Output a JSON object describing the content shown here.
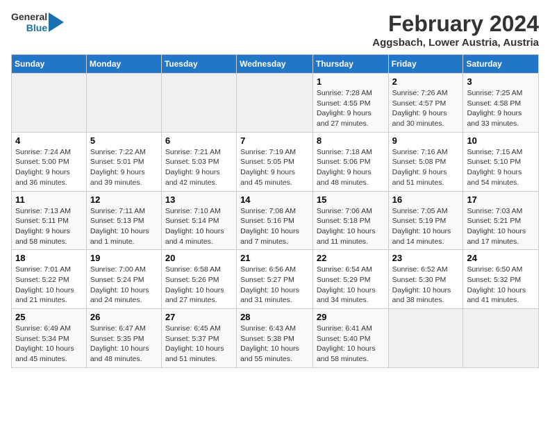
{
  "logo": {
    "text_general": "General",
    "text_blue": "Blue"
  },
  "title": "February 2024",
  "subtitle": "Aggsbach, Lower Austria, Austria",
  "columns": [
    "Sunday",
    "Monday",
    "Tuesday",
    "Wednesday",
    "Thursday",
    "Friday",
    "Saturday"
  ],
  "weeks": [
    [
      {
        "day": "",
        "info": ""
      },
      {
        "day": "",
        "info": ""
      },
      {
        "day": "",
        "info": ""
      },
      {
        "day": "",
        "info": ""
      },
      {
        "day": "1",
        "info": "Sunrise: 7:28 AM\nSunset: 4:55 PM\nDaylight: 9 hours and 27 minutes."
      },
      {
        "day": "2",
        "info": "Sunrise: 7:26 AM\nSunset: 4:57 PM\nDaylight: 9 hours and 30 minutes."
      },
      {
        "day": "3",
        "info": "Sunrise: 7:25 AM\nSunset: 4:58 PM\nDaylight: 9 hours and 33 minutes."
      }
    ],
    [
      {
        "day": "4",
        "info": "Sunrise: 7:24 AM\nSunset: 5:00 PM\nDaylight: 9 hours and 36 minutes."
      },
      {
        "day": "5",
        "info": "Sunrise: 7:22 AM\nSunset: 5:01 PM\nDaylight: 9 hours and 39 minutes."
      },
      {
        "day": "6",
        "info": "Sunrise: 7:21 AM\nSunset: 5:03 PM\nDaylight: 9 hours and 42 minutes."
      },
      {
        "day": "7",
        "info": "Sunrise: 7:19 AM\nSunset: 5:05 PM\nDaylight: 9 hours and 45 minutes."
      },
      {
        "day": "8",
        "info": "Sunrise: 7:18 AM\nSunset: 5:06 PM\nDaylight: 9 hours and 48 minutes."
      },
      {
        "day": "9",
        "info": "Sunrise: 7:16 AM\nSunset: 5:08 PM\nDaylight: 9 hours and 51 minutes."
      },
      {
        "day": "10",
        "info": "Sunrise: 7:15 AM\nSunset: 5:10 PM\nDaylight: 9 hours and 54 minutes."
      }
    ],
    [
      {
        "day": "11",
        "info": "Sunrise: 7:13 AM\nSunset: 5:11 PM\nDaylight: 9 hours and 58 minutes."
      },
      {
        "day": "12",
        "info": "Sunrise: 7:11 AM\nSunset: 5:13 PM\nDaylight: 10 hours and 1 minute."
      },
      {
        "day": "13",
        "info": "Sunrise: 7:10 AM\nSunset: 5:14 PM\nDaylight: 10 hours and 4 minutes."
      },
      {
        "day": "14",
        "info": "Sunrise: 7:08 AM\nSunset: 5:16 PM\nDaylight: 10 hours and 7 minutes."
      },
      {
        "day": "15",
        "info": "Sunrise: 7:06 AM\nSunset: 5:18 PM\nDaylight: 10 hours and 11 minutes."
      },
      {
        "day": "16",
        "info": "Sunrise: 7:05 AM\nSunset: 5:19 PM\nDaylight: 10 hours and 14 minutes."
      },
      {
        "day": "17",
        "info": "Sunrise: 7:03 AM\nSunset: 5:21 PM\nDaylight: 10 hours and 17 minutes."
      }
    ],
    [
      {
        "day": "18",
        "info": "Sunrise: 7:01 AM\nSunset: 5:22 PM\nDaylight: 10 hours and 21 minutes."
      },
      {
        "day": "19",
        "info": "Sunrise: 7:00 AM\nSunset: 5:24 PM\nDaylight: 10 hours and 24 minutes."
      },
      {
        "day": "20",
        "info": "Sunrise: 6:58 AM\nSunset: 5:26 PM\nDaylight: 10 hours and 27 minutes."
      },
      {
        "day": "21",
        "info": "Sunrise: 6:56 AM\nSunset: 5:27 PM\nDaylight: 10 hours and 31 minutes."
      },
      {
        "day": "22",
        "info": "Sunrise: 6:54 AM\nSunset: 5:29 PM\nDaylight: 10 hours and 34 minutes."
      },
      {
        "day": "23",
        "info": "Sunrise: 6:52 AM\nSunset: 5:30 PM\nDaylight: 10 hours and 38 minutes."
      },
      {
        "day": "24",
        "info": "Sunrise: 6:50 AM\nSunset: 5:32 PM\nDaylight: 10 hours and 41 minutes."
      }
    ],
    [
      {
        "day": "25",
        "info": "Sunrise: 6:49 AM\nSunset: 5:34 PM\nDaylight: 10 hours and 45 minutes."
      },
      {
        "day": "26",
        "info": "Sunrise: 6:47 AM\nSunset: 5:35 PM\nDaylight: 10 hours and 48 minutes."
      },
      {
        "day": "27",
        "info": "Sunrise: 6:45 AM\nSunset: 5:37 PM\nDaylight: 10 hours and 51 minutes."
      },
      {
        "day": "28",
        "info": "Sunrise: 6:43 AM\nSunset: 5:38 PM\nDaylight: 10 hours and 55 minutes."
      },
      {
        "day": "29",
        "info": "Sunrise: 6:41 AM\nSunset: 5:40 PM\nDaylight: 10 hours and 58 minutes."
      },
      {
        "day": "",
        "info": ""
      },
      {
        "day": "",
        "info": ""
      }
    ]
  ]
}
